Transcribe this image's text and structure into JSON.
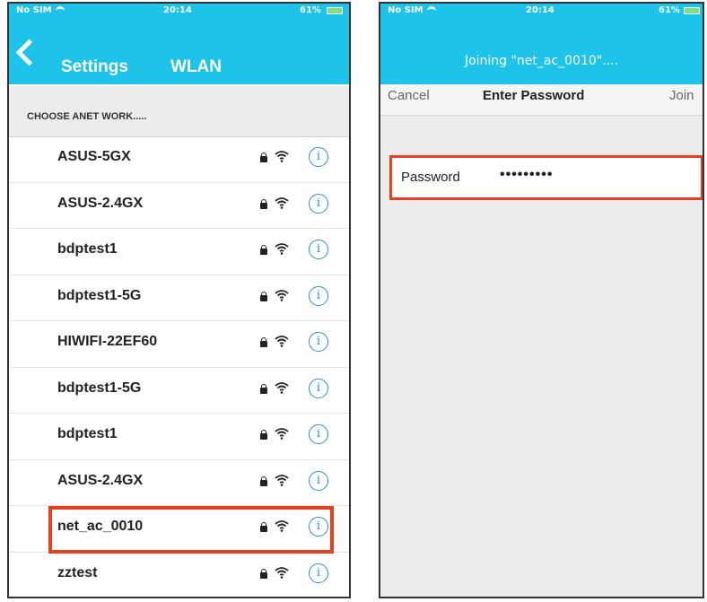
{
  "left_screen": {
    "status": {
      "carrier": "No SIM",
      "time": "20:14",
      "battery": "61%"
    },
    "nav": {
      "back_label": "Settings",
      "title": "WLAN"
    },
    "section_header": "CHOOSE ANET WORK.....",
    "networks": [
      {
        "name": "ASUS-5GX"
      },
      {
        "name": "ASUS-2.4GX"
      },
      {
        "name": "bdptest1"
      },
      {
        "name": "bdptest1-5G"
      },
      {
        "name": "HIWIFI-22EF60"
      },
      {
        "name": "bdptest1-5G"
      },
      {
        "name": "bdptest1"
      },
      {
        "name": "ASUS-2.4GX"
      },
      {
        "name": "net_ac_0010",
        "selected": true
      },
      {
        "name": "zztest"
      }
    ],
    "info_glyph": "i"
  },
  "right_screen": {
    "status": {
      "carrier": "No SIM",
      "time": "20:14",
      "battery": "61%"
    },
    "title": "Joining \"net_ac_0010\"....",
    "actions": {
      "cancel": "Cancel",
      "title": "Enter Password",
      "join": "Join"
    },
    "password": {
      "label": "Password",
      "value": "•••••••••"
    }
  },
  "colors": {
    "accent": "#1ec3ea",
    "highlight": "#e6401f",
    "info": "#2b8cd6"
  }
}
